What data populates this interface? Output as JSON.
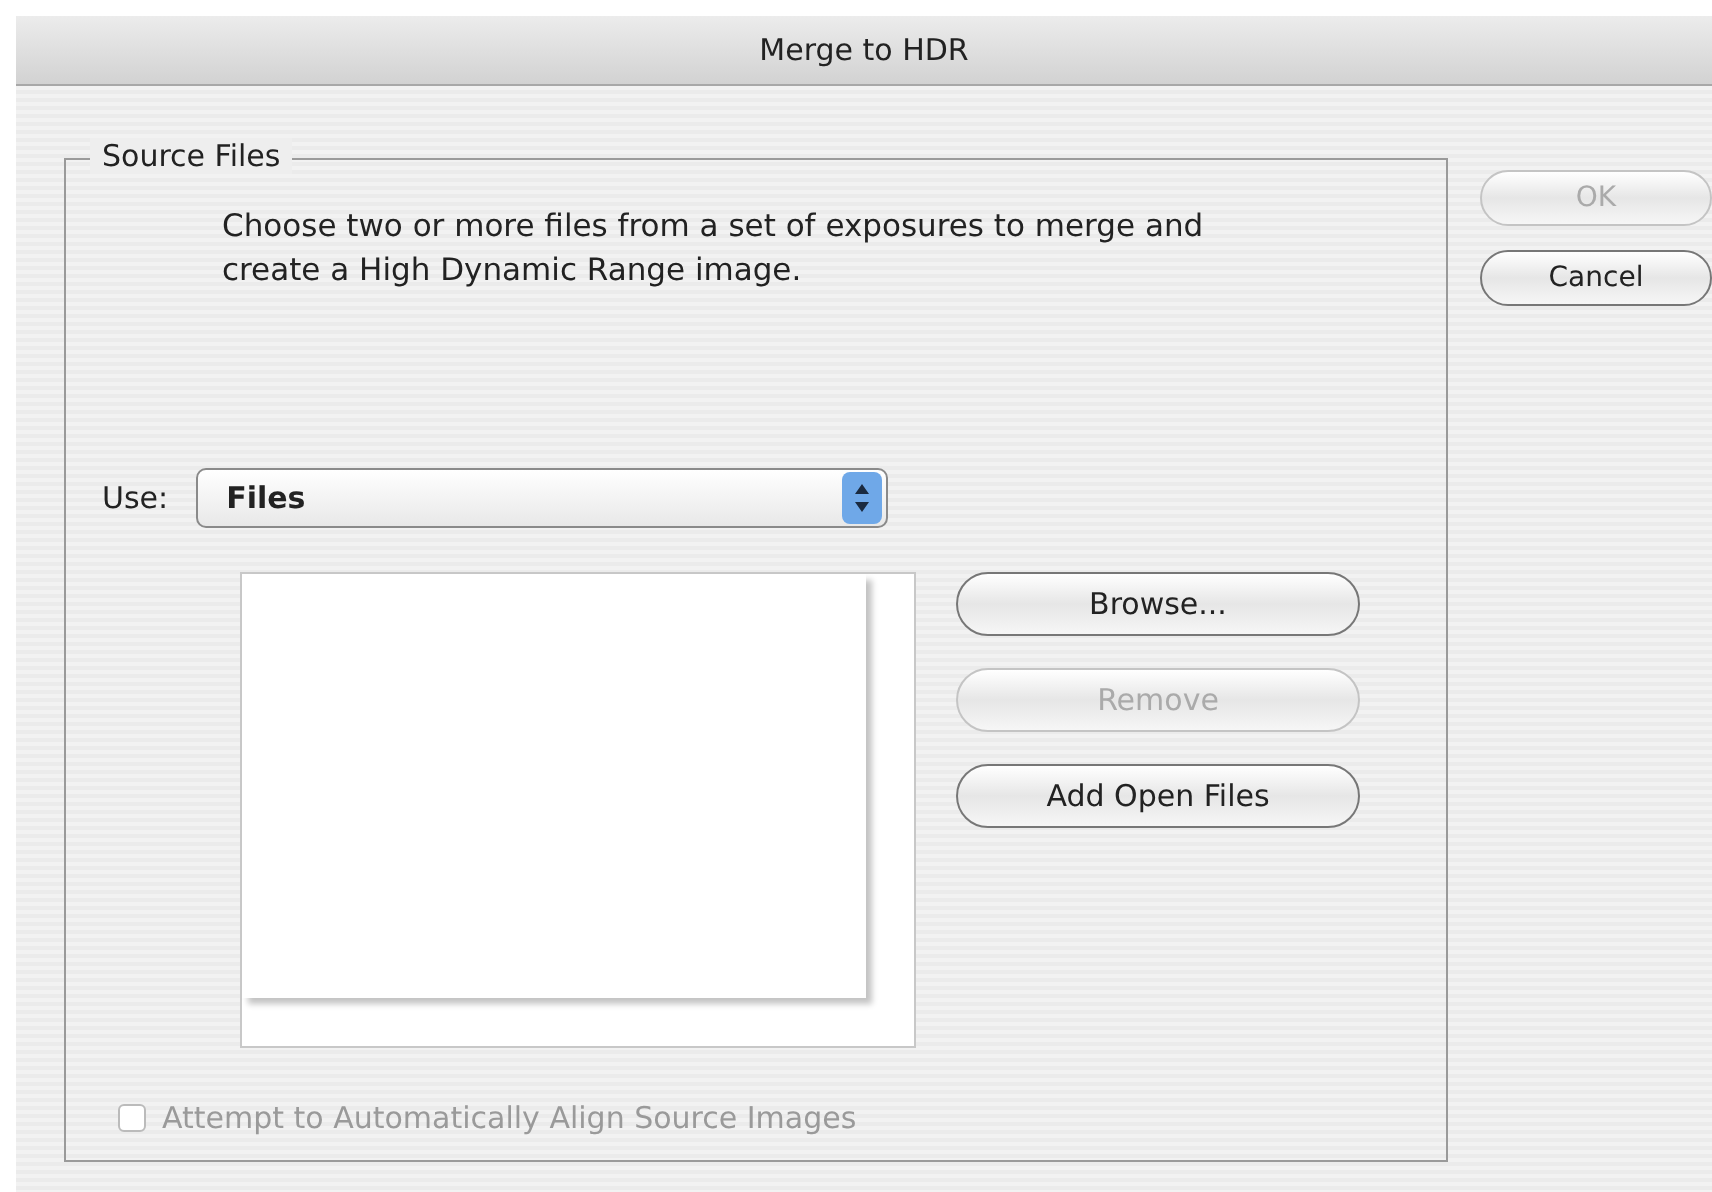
{
  "window": {
    "title": "Merge to HDR"
  },
  "source_files": {
    "legend": "Source Files",
    "description": "Choose two or more files from a set of exposures to merge and create a High Dynamic Range image.",
    "use_label": "Use:",
    "use_value": "Files",
    "buttons": [
      {
        "label": "Browse...",
        "disabled": false
      },
      {
        "label": "Remove",
        "disabled": true
      },
      {
        "label": "Add Open Files",
        "disabled": false
      }
    ],
    "align_checkbox": {
      "label": "Attempt to Automatically Align Source Images",
      "checked": false,
      "disabled": true
    }
  },
  "dialog_buttons": [
    {
      "label": "OK",
      "disabled": true
    },
    {
      "label": "Cancel",
      "disabled": false
    }
  ]
}
